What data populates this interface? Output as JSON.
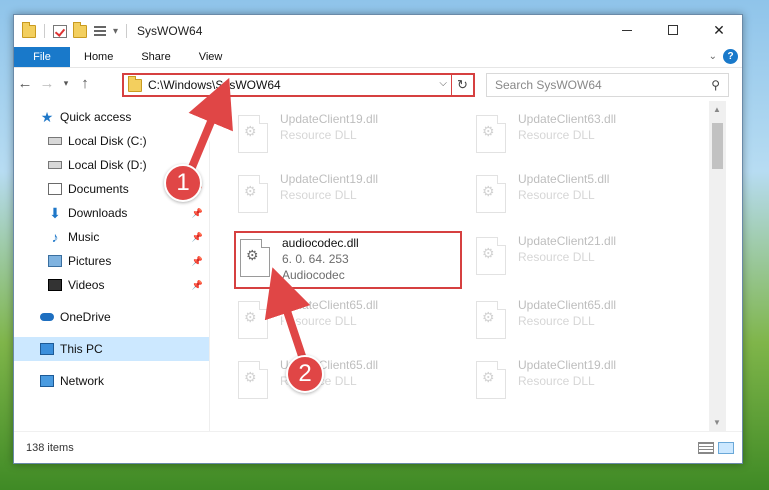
{
  "window": {
    "title": "SysWOW64"
  },
  "ribbon": {
    "tabs": [
      "File",
      "Home",
      "Share",
      "View"
    ]
  },
  "address": {
    "path": "C:\\Windows\\SysWOW64"
  },
  "search": {
    "placeholder": "Search SysWOW64"
  },
  "sidebar": {
    "items": [
      {
        "label": "Quick access",
        "icon": "star-icon",
        "pinned": false
      },
      {
        "label": "Local Disk (C:)",
        "icon": "drive-icon",
        "pinned": false
      },
      {
        "label": "Local Disk (D:)",
        "icon": "drive-icon",
        "pinned": false
      },
      {
        "label": "Documents",
        "icon": "documents-icon",
        "pinned": true
      },
      {
        "label": "Downloads",
        "icon": "download-icon",
        "pinned": true
      },
      {
        "label": "Music",
        "icon": "music-icon",
        "pinned": true
      },
      {
        "label": "Pictures",
        "icon": "pictures-icon",
        "pinned": true
      },
      {
        "label": "Videos",
        "icon": "videos-icon",
        "pinned": true
      },
      {
        "label": "OneDrive",
        "icon": "onedrive-icon",
        "pinned": false
      },
      {
        "label": "This PC",
        "icon": "computer-icon",
        "pinned": false,
        "selected": true
      },
      {
        "label": "Network",
        "icon": "network-icon",
        "pinned": false
      }
    ]
  },
  "files": {
    "highlighted": {
      "name": "audiocodec.dll",
      "version": "6. 0. 64. 253",
      "description": "Audiocodec"
    },
    "background": [
      {
        "name": "UpdateClient19.dll",
        "type": "Resource DLL"
      },
      {
        "name": "UpdateClient63.dll",
        "type": "Resource DLL"
      },
      {
        "name": "UpdateClient19.dll",
        "type": "Resource DLL"
      },
      {
        "name": "UpdateClient5.dll",
        "type": "Resource DLL"
      },
      {
        "name": "UpdateClient21.dll",
        "type": "Resource DLL"
      },
      {
        "name": "UpdateClient65.dll",
        "type": "Resource DLL"
      },
      {
        "name": "UpdateClient65.dll",
        "type": "Resource DLL"
      },
      {
        "name": "UpdateClient65.dll",
        "type": "Resource DLL"
      },
      {
        "name": "UpdateClient19.dll",
        "type": "Resource DLL"
      }
    ]
  },
  "status": {
    "item_count": "138 items"
  },
  "callouts": [
    "1",
    "2"
  ],
  "colors": {
    "accent": "#1979ca",
    "highlight": "#d64040",
    "selection": "#cce8ff"
  }
}
